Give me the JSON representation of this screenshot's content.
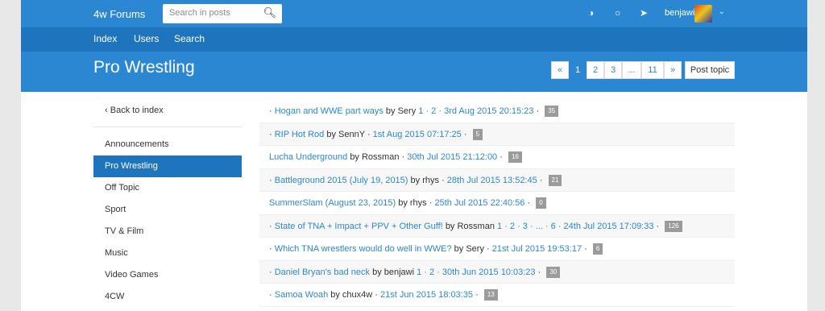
{
  "header": {
    "brand": "4w Forums",
    "search_placeholder": "Search in posts",
    "username": "benjawi"
  },
  "nav": {
    "index": "Index",
    "users": "Users",
    "search": "Search"
  },
  "page": {
    "title": "Pro Wrestling",
    "post_topic": "Post topic"
  },
  "pagination": {
    "prev": "«",
    "p1": "1",
    "p2": "2",
    "p3": "3",
    "ellipsis": "...",
    "p11": "11",
    "next": "»"
  },
  "sidebar": {
    "back": "Back to index",
    "categories": [
      "Announcements",
      "Pro Wrestling",
      "Off Topic",
      "Sport",
      "TV & Film",
      "Music",
      "Video Games",
      "4CW"
    ]
  },
  "topics": [
    {
      "bullet": "·",
      "title": "Hogan and WWE part ways",
      "by": "by Sery",
      "pages": "1 · 2 ·",
      "date": "3rd Aug 2015 20:15:23",
      "sep": "·",
      "count": "35"
    },
    {
      "bullet": "·",
      "title": "RIP Hot Rod",
      "by": "by SennY",
      "pages": "·",
      "date": "1st Aug 2015 07:17:25",
      "sep": "·",
      "count": "5"
    },
    {
      "bullet": "",
      "title": "Lucha Underground",
      "by": "by Rossman",
      "pages": "·",
      "date": "30th Jul 2015 21:12:00",
      "sep": "·",
      "count": "16"
    },
    {
      "bullet": "·",
      "title": "Battleground 2015 (July 19, 2015)",
      "by": "by rhys",
      "pages": "·",
      "date": "28th Jul 2015 13:52:45",
      "sep": "·",
      "count": "21"
    },
    {
      "bullet": "",
      "title": "SummerSlam (August 23, 2015)",
      "by": "by rhys",
      "pages": "·",
      "date": "25th Jul 2015 22:40:56",
      "sep": "·",
      "count": "0"
    },
    {
      "bullet": "·",
      "title": "State of TNA + Impact + PPV + Other Guff!",
      "by": "by Rossman",
      "pages": "1 · 2 · 3 · ... · 6 ·",
      "date": "24th Jul 2015 17:09:33",
      "sep": "·",
      "count": "126"
    },
    {
      "bullet": "·",
      "title": "Which TNA wrestlers would do well in WWE?",
      "by": "by Sery",
      "pages": "·",
      "date": "21st Jul 2015 19:53:17",
      "sep": "·",
      "count": "6"
    },
    {
      "bullet": "·",
      "title": "Daniel Bryan's bad neck",
      "by": "by benjawi",
      "pages": "1 · 2 ·",
      "date": "30th Jun 2015 10:03:23",
      "sep": "·",
      "count": "30"
    },
    {
      "bullet": "·",
      "title": "Samoa Woah",
      "by": "by chux4w",
      "pages": "·",
      "date": "21st Jun 2015 18:03:35",
      "sep": "·",
      "count": "13"
    }
  ],
  "icons": {
    "search": "search-icon",
    "dashboard": "dashboard-icon",
    "circle": "circle-icon",
    "send": "paper-plane-icon",
    "chevron": "chevron-down-icon",
    "back": "chevron-left-icon"
  },
  "colors": {
    "primary": "#2b87d1",
    "nav": "#1f75bd",
    "badge": "#9b9b9b"
  }
}
